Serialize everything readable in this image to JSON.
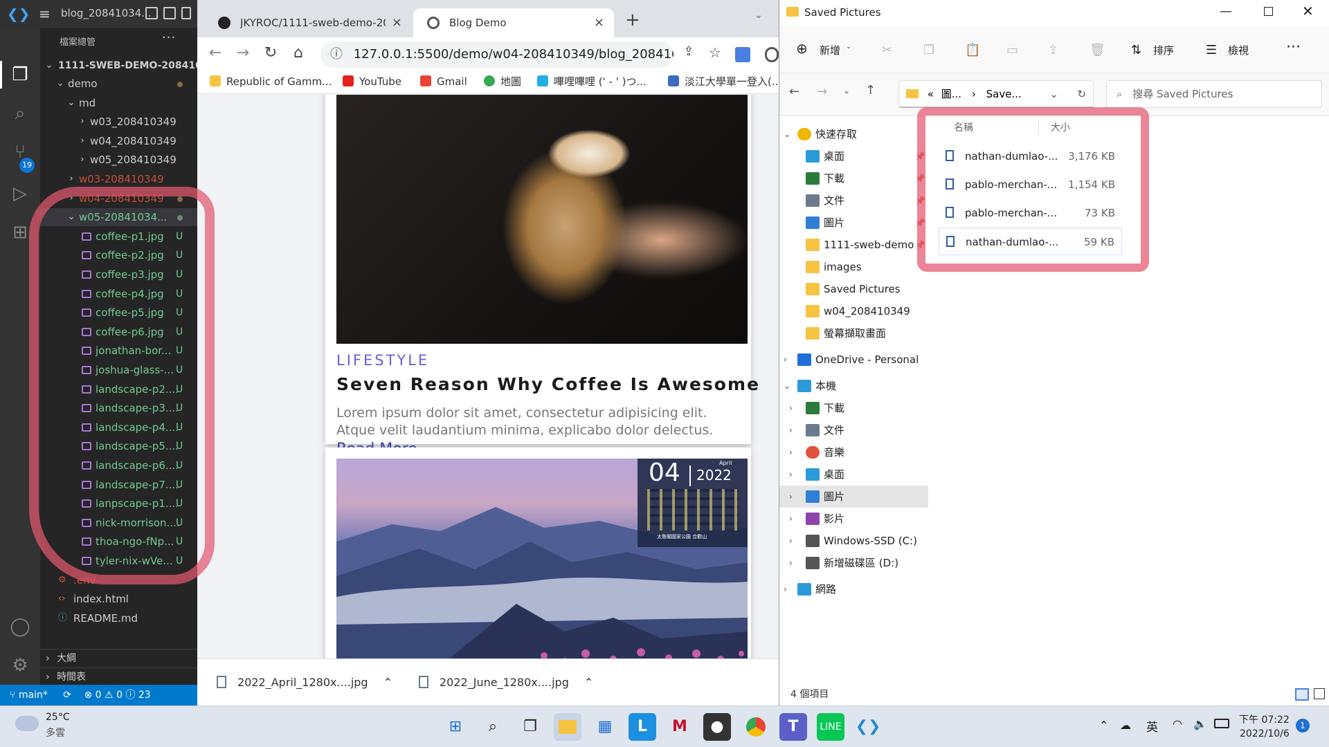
{
  "vscode": {
    "window_title": "blog_20841034...",
    "explorer_header": "檔案總管",
    "scm_badge": "19",
    "workspace": "1111-SWEB-DEMO-208410...",
    "tree": [
      {
        "label": "demo",
        "indent": 1,
        "chev": "v",
        "kind": "folder",
        "color": "#cccccc",
        "dot": true
      },
      {
        "label": "md",
        "indent": 2,
        "chev": "v",
        "kind": "folder",
        "color": "#cccccc"
      },
      {
        "label": "w03_208410349",
        "indent": 3,
        "chev": ">",
        "kind": "folder",
        "color": "#cccccc"
      },
      {
        "label": "w04_208410349",
        "indent": 3,
        "chev": ">",
        "kind": "folder",
        "color": "#cccccc"
      },
      {
        "label": "w05_208410349",
        "indent": 3,
        "chev": ">",
        "kind": "folder",
        "color": "#cccccc"
      },
      {
        "label": "w03-208410349",
        "indent": 2,
        "chev": ">",
        "kind": "folder",
        "color": "#c74e39"
      },
      {
        "label": "w04-208410349",
        "indent": 2,
        "chev": ">",
        "kind": "folder",
        "color": "#c74e39",
        "dot": true
      },
      {
        "label": "w05-20841034...",
        "indent": 2,
        "chev": "v",
        "kind": "folder",
        "color": "#73c991",
        "dot": true,
        "selected": true
      },
      {
        "label": "coffee-p1.jpg",
        "indent": 3,
        "kind": "img",
        "color": "#73c991",
        "status": "U"
      },
      {
        "label": "coffee-p2.jpg",
        "indent": 3,
        "kind": "img",
        "color": "#73c991",
        "status": "U"
      },
      {
        "label": "coffee-p3.jpg",
        "indent": 3,
        "kind": "img",
        "color": "#73c991",
        "status": "U"
      },
      {
        "label": "coffee-p4.jpg",
        "indent": 3,
        "kind": "img",
        "color": "#73c991",
        "status": "U"
      },
      {
        "label": "coffee-p5.jpg",
        "indent": 3,
        "kind": "img",
        "color": "#73c991",
        "status": "U"
      },
      {
        "label": "coffee-p6.jpg",
        "indent": 3,
        "kind": "img",
        "color": "#73c991",
        "status": "U"
      },
      {
        "label": "jonathan-bor...",
        "indent": 3,
        "kind": "img",
        "color": "#73c991",
        "status": "U"
      },
      {
        "label": "joshua-glass-...",
        "indent": 3,
        "kind": "img",
        "color": "#73c991",
        "status": "U"
      },
      {
        "label": "landscape-p2....",
        "indent": 3,
        "kind": "img",
        "color": "#73c991",
        "status": "U"
      },
      {
        "label": "landscape-p3....",
        "indent": 3,
        "kind": "img",
        "color": "#73c991",
        "status": "U"
      },
      {
        "label": "landscape-p4....",
        "indent": 3,
        "kind": "img",
        "color": "#73c991",
        "status": "U"
      },
      {
        "label": "landscape-p5....",
        "indent": 3,
        "kind": "img",
        "color": "#73c991",
        "status": "U"
      },
      {
        "label": "landscape-p6....",
        "indent": 3,
        "kind": "img",
        "color": "#73c991",
        "status": "U"
      },
      {
        "label": "landscape-p7....",
        "indent": 3,
        "kind": "img",
        "color": "#73c991",
        "status": "U"
      },
      {
        "label": "lanpscape-p1....",
        "indent": 3,
        "kind": "img",
        "color": "#73c991",
        "status": "U"
      },
      {
        "label": "nick-morrison....",
        "indent": 3,
        "kind": "img",
        "color": "#73c991",
        "status": "U"
      },
      {
        "label": "thoa-ngo-fNp...",
        "indent": 3,
        "kind": "img",
        "color": "#73c991",
        "status": "U"
      },
      {
        "label": "tyler-nix-wVe...",
        "indent": 3,
        "kind": "img",
        "color": "#73c991",
        "status": "U"
      },
      {
        "label": ".env",
        "indent": 1,
        "kind": "gear",
        "color": "#c74e39"
      },
      {
        "label": "index.html",
        "indent": 1,
        "kind": "html",
        "color": "#cccccc"
      },
      {
        "label": "README.md",
        "indent": 1,
        "kind": "info",
        "color": "#cccccc"
      }
    ],
    "outline_label": "大綱",
    "timeline_label": "時間表",
    "status": {
      "branch": "main*",
      "errors": "0",
      "warnings": "0",
      "info": "23"
    }
  },
  "chrome": {
    "tabs": [
      {
        "title": "JKYROC/1111-sweb-demo-208",
        "active": false
      },
      {
        "title": "Blog Demo",
        "active": true
      }
    ],
    "url": "127.0.0.1:5500/demo/w04-208410349/blog_2084103...",
    "bookmarks": [
      "Republic of Gamm...",
      "YouTube",
      "Gmail",
      "地圖",
      "嗶哩嗶哩 (' - ' )つ...",
      "淡江大學單一登入(..."
    ],
    "card1": {
      "category": "LIFESTYLE",
      "title": "Seven Reason Why Coffee Is Awesome",
      "description": "Lorem ipsum dolor sit amet, consectetur adipisicing elit. Atque velit laudantium minima, explicabo dolor delectus.",
      "read_more": "Read More"
    },
    "calendar": {
      "day": "04",
      "month": "April",
      "year": "2022",
      "caption": "太魯閣國家公園 合歡山"
    },
    "downloads": [
      "2022_April_1280x....jpg",
      "2022_June_1280x....jpg"
    ]
  },
  "explorer": {
    "title": "Saved Pictures",
    "new_label": "新增",
    "sort_label": "排序",
    "view_label": "檢視",
    "address": [
      "«",
      "圖...",
      "›",
      "Save..."
    ],
    "search_placeholder": "搜尋 Saved Pictures",
    "nav": [
      {
        "label": "快速存取",
        "level": 0,
        "chev": "v",
        "icon": "star",
        "pin": false
      },
      {
        "label": "桌面",
        "level": 1,
        "icon": "desktop",
        "pin": true
      },
      {
        "label": "下載",
        "level": 1,
        "icon": "download",
        "pin": true
      },
      {
        "label": "文件",
        "level": 1,
        "icon": "doc",
        "pin": true
      },
      {
        "label": "圖片",
        "level": 1,
        "icon": "pictures",
        "pin": true
      },
      {
        "label": "1111-sweb-demo",
        "level": 1,
        "icon": "folder",
        "pin": true
      },
      {
        "label": "images",
        "level": 1,
        "icon": "folder"
      },
      {
        "label": "Saved Pictures",
        "level": 1,
        "icon": "folder"
      },
      {
        "label": "w04_208410349",
        "level": 1,
        "icon": "folder"
      },
      {
        "label": "螢幕擷取畫面",
        "level": 1,
        "icon": "folder"
      },
      {
        "label": "OneDrive - Personal",
        "level": 0,
        "chev": ">",
        "icon": "cloud",
        "gap": true
      },
      {
        "label": "本機",
        "level": 0,
        "chev": "v",
        "icon": "pc",
        "gap": true
      },
      {
        "label": "下載",
        "level": 1,
        "chev": ">",
        "icon": "download"
      },
      {
        "label": "文件",
        "level": 1,
        "chev": ">",
        "icon": "doc"
      },
      {
        "label": "音樂",
        "level": 1,
        "chev": ">",
        "icon": "music"
      },
      {
        "label": "桌面",
        "level": 1,
        "chev": ">",
        "icon": "desktop"
      },
      {
        "label": "圖片",
        "level": 1,
        "chev": ">",
        "icon": "pictures",
        "selected": true
      },
      {
        "label": "影片",
        "level": 1,
        "chev": ">",
        "icon": "video"
      },
      {
        "label": "Windows-SSD (C:)",
        "level": 1,
        "chev": ">",
        "icon": "drive"
      },
      {
        "label": "新增磁碟區 (D:)",
        "level": 1,
        "chev": ">",
        "icon": "drive"
      },
      {
        "label": "網路",
        "level": 0,
        "chev": ">",
        "icon": "network",
        "gap": true
      }
    ],
    "columns": {
      "name": "名稱",
      "size": "大小"
    },
    "files": [
      {
        "name": "nathan-dumlao-...",
        "size": "3,176 KB"
      },
      {
        "name": "pablo-merchan-...",
        "size": "1,154 KB"
      },
      {
        "name": "pablo-merchan-...",
        "size": "73 KB"
      },
      {
        "name": "nathan-dumlao-...",
        "size": "59 KB",
        "selected": true
      }
    ],
    "status": "4 個項目"
  },
  "taskbar": {
    "weather_temp": "25°C",
    "weather_desc": "多雲",
    "ime": "英",
    "time": "下午 07:22",
    "date": "2022/10/6",
    "notif_count": "1"
  }
}
